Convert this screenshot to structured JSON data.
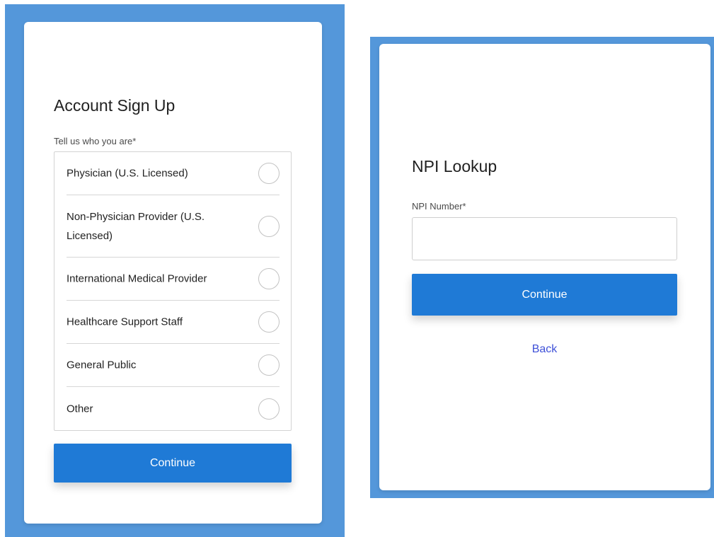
{
  "signup": {
    "title": "Account Sign Up",
    "prompt_label": "Tell us who you are",
    "required_marker": "*",
    "options": [
      {
        "label": "Physician (U.S. Licensed)"
      },
      {
        "label": "Non-Physician Provider (U.S. Licensed)"
      },
      {
        "label": "International Medical Provider"
      },
      {
        "label": "Healthcare Support Staff"
      },
      {
        "label": "General Public"
      },
      {
        "label": "Other"
      }
    ],
    "continue_label": "Continue"
  },
  "npi": {
    "title": "NPI Lookup",
    "field_label": "NPI Number",
    "required_marker": "*",
    "field_value": "",
    "continue_label": "Continue",
    "back_label": "Back"
  },
  "colors": {
    "background_panel": "#5497da",
    "button": "#1f7ad6",
    "link": "#3f51d8"
  }
}
